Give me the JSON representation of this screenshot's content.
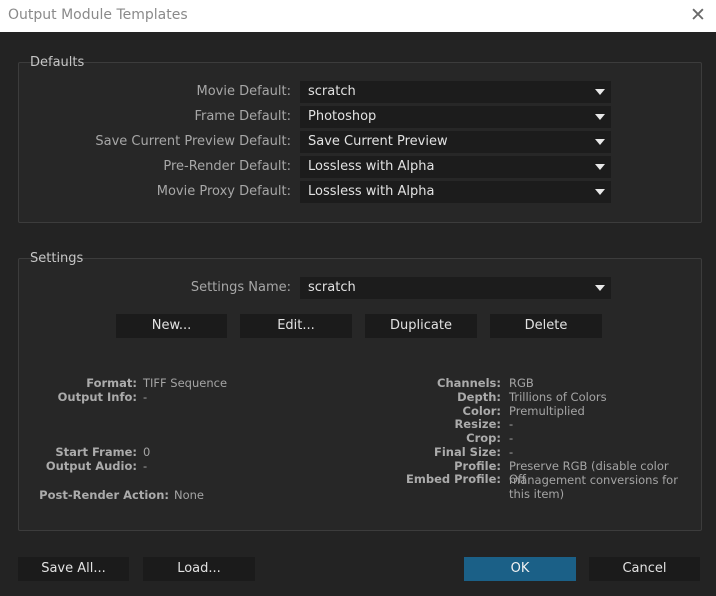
{
  "window": {
    "title": "Output Module Templates",
    "close_icon": "close-icon"
  },
  "defaults": {
    "group_label": "Defaults",
    "rows": [
      {
        "label": "Movie Default:",
        "value": "scratch"
      },
      {
        "label": "Frame Default:",
        "value": "Photoshop"
      },
      {
        "label": "Save Current Preview Default:",
        "value": "Save Current Preview"
      },
      {
        "label": "Pre-Render Default:",
        "value": "Lossless with Alpha"
      },
      {
        "label": "Movie Proxy Default:",
        "value": "Lossless with Alpha"
      }
    ]
  },
  "settings": {
    "group_label": "Settings",
    "name_label": "Settings Name:",
    "name_value": "scratch",
    "buttons": {
      "new": "New...",
      "edit": "Edit...",
      "duplicate": "Duplicate",
      "delete": "Delete"
    },
    "info_left": {
      "format_label": "Format:",
      "format_value": "TIFF Sequence",
      "output_info_label": "Output Info:",
      "output_info_value": "-",
      "start_frame_label": "Start Frame:",
      "start_frame_value": "0",
      "output_audio_label": "Output Audio:",
      "output_audio_value": "-",
      "post_render_label": "Post-Render Action:",
      "post_render_value": "None"
    },
    "info_right": {
      "channels_label": "Channels:",
      "channels_value": "RGB",
      "depth_label": "Depth:",
      "depth_value": "Trillions of Colors",
      "color_label": "Color:",
      "color_value": "Premultiplied",
      "resize_label": "Resize:",
      "resize_value": "-",
      "crop_label": "Crop:",
      "crop_value": "-",
      "final_size_label": "Final Size:",
      "final_size_value": "-",
      "profile_label": "Profile:",
      "profile_value_line1": "Preserve RGB (disable color",
      "profile_value_line2": "management conversions for",
      "profile_value_line3": "this item)",
      "embed_profile_label": "Embed Profile:",
      "embed_profile_value": "Off"
    }
  },
  "footer": {
    "save_all": "Save All...",
    "load": "Load...",
    "ok": "OK",
    "cancel": "Cancel"
  },
  "colors": {
    "accent": "#1b6087",
    "background": "#232323"
  }
}
